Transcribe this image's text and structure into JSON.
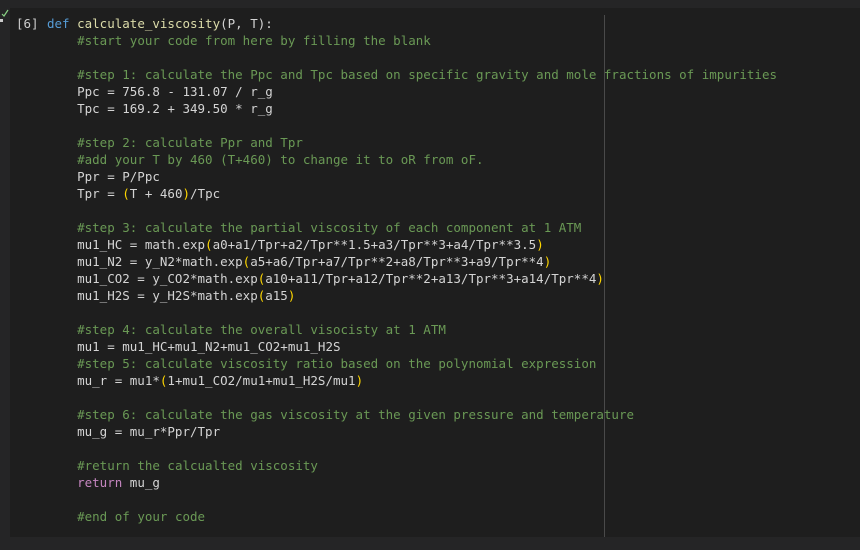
{
  "cell": {
    "label": "[6]",
    "status_icon": "check-icon"
  },
  "code_lines": [
    [
      [
        "keyword",
        "def "
      ],
      [
        "fn",
        "calculate_viscosity"
      ],
      [
        "plain",
        "(P, T):"
      ]
    ],
    [
      [
        "plain",
        "    "
      ],
      [
        "comment",
        "#start your code from here by filling the blank"
      ]
    ],
    [],
    [
      [
        "plain",
        "    "
      ],
      [
        "comment",
        "#step 1: calculate the Ppc and Tpc based on specific gravity and mole fractions of impurities"
      ]
    ],
    [
      [
        "plain",
        "    Ppc = 756.8 - 131.07 / r_g"
      ]
    ],
    [
      [
        "plain",
        "    Tpc = 169.2 + 349.50 * r_g"
      ]
    ],
    [],
    [
      [
        "plain",
        "    "
      ],
      [
        "comment",
        "#step 2: calculate Ppr and Tpr"
      ]
    ],
    [
      [
        "plain",
        "    "
      ],
      [
        "comment",
        "#add your T by 460 (T+460) to change it to oR from oF."
      ]
    ],
    [
      [
        "plain",
        "    Ppr = P/Ppc"
      ]
    ],
    [
      [
        "plain",
        "    Tpr = "
      ],
      [
        "paren",
        "("
      ],
      [
        "plain",
        "T + 460"
      ],
      [
        "paren",
        ")"
      ],
      [
        "plain",
        "/Tpc"
      ]
    ],
    [],
    [
      [
        "plain",
        "    "
      ],
      [
        "comment",
        "#step 3: calculate the partial viscosity of each component at 1 ATM"
      ]
    ],
    [
      [
        "plain",
        "    mu1_HC = math.exp"
      ],
      [
        "paren",
        "("
      ],
      [
        "plain",
        "a0+a1/Tpr+a2/Tpr**1.5+a3/Tpr**3+a4/Tpr**3.5"
      ],
      [
        "paren",
        ")"
      ]
    ],
    [
      [
        "plain",
        "    mu1_N2 = y_N2*math.exp"
      ],
      [
        "paren",
        "("
      ],
      [
        "plain",
        "a5+a6/Tpr+a7/Tpr**2+a8/Tpr**3+a9/Tpr**4"
      ],
      [
        "paren",
        ")"
      ]
    ],
    [
      [
        "plain",
        "    mu1_CO2 = y_CO2*math.exp"
      ],
      [
        "paren",
        "("
      ],
      [
        "plain",
        "a10+a11/Tpr+a12/Tpr**2+a13/Tpr**3+a14/Tpr**4"
      ],
      [
        "paren",
        ")"
      ]
    ],
    [
      [
        "plain",
        "    mu1_H2S = y_H2S*math.exp"
      ],
      [
        "paren",
        "("
      ],
      [
        "plain",
        "a15"
      ],
      [
        "paren",
        ")"
      ]
    ],
    [],
    [
      [
        "plain",
        "    "
      ],
      [
        "comment",
        "#step 4: calculate the overall visocisty at 1 ATM"
      ]
    ],
    [
      [
        "plain",
        "    mu1 = mu1_HC+mu1_N2+mu1_CO2+mu1_H2S"
      ]
    ],
    [
      [
        "plain",
        "    "
      ],
      [
        "comment",
        "#step 5: calculate viscosity ratio based on the polynomial expression"
      ]
    ],
    [
      [
        "plain",
        "    mu_r = mu1*"
      ],
      [
        "paren",
        "("
      ],
      [
        "plain",
        "1+mu1_CO2/mu1+mu1_H2S/mu1"
      ],
      [
        "paren",
        ")"
      ]
    ],
    [],
    [
      [
        "plain",
        "    "
      ],
      [
        "comment",
        "#step 6: calculate the gas viscosity at the given pressure and temperature"
      ]
    ],
    [
      [
        "plain",
        "    mu_g = mu_r*Ppr/Tpr"
      ]
    ],
    [],
    [
      [
        "plain",
        "    "
      ],
      [
        "comment",
        "#return the calcualted viscosity"
      ]
    ],
    [
      [
        "plain",
        "    "
      ],
      [
        "ctrl",
        "return"
      ],
      [
        "plain",
        " mu_g"
      ]
    ],
    [],
    [
      [
        "plain",
        "    "
      ],
      [
        "comment",
        "#end of your code"
      ]
    ]
  ]
}
